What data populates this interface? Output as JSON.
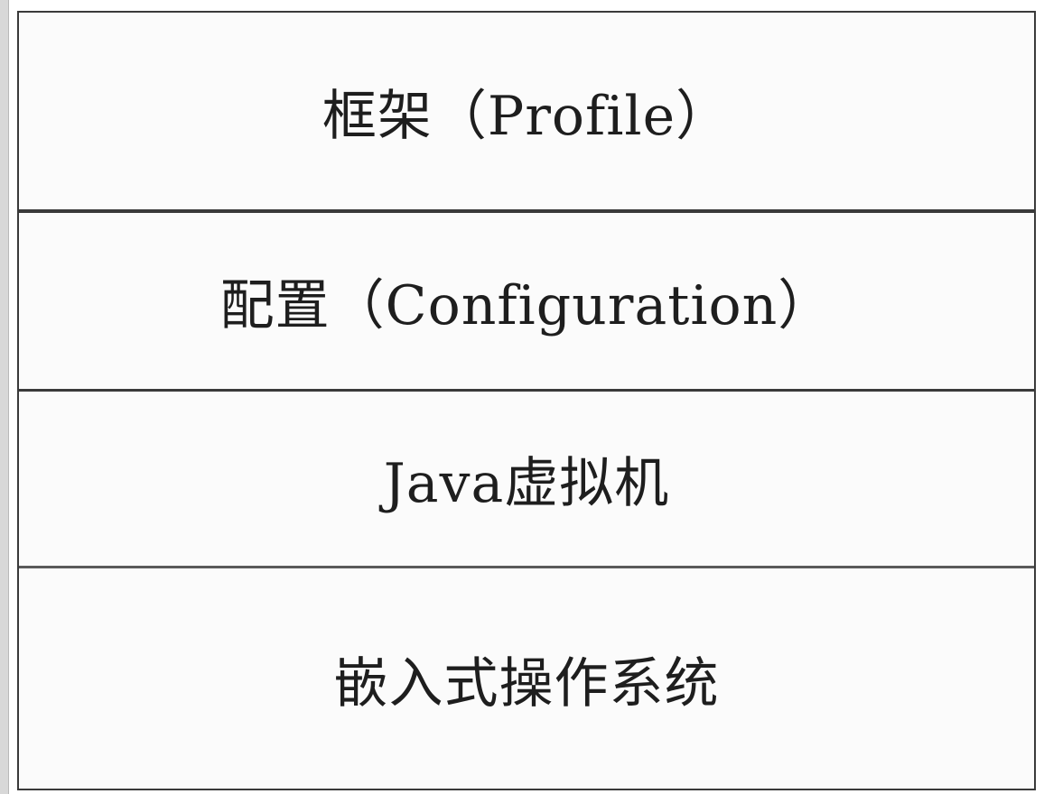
{
  "diagram": {
    "layers": [
      "框架（Profile）",
      "配置（Configuration）",
      "Java虚拟机",
      "嵌入式操作系统"
    ]
  }
}
